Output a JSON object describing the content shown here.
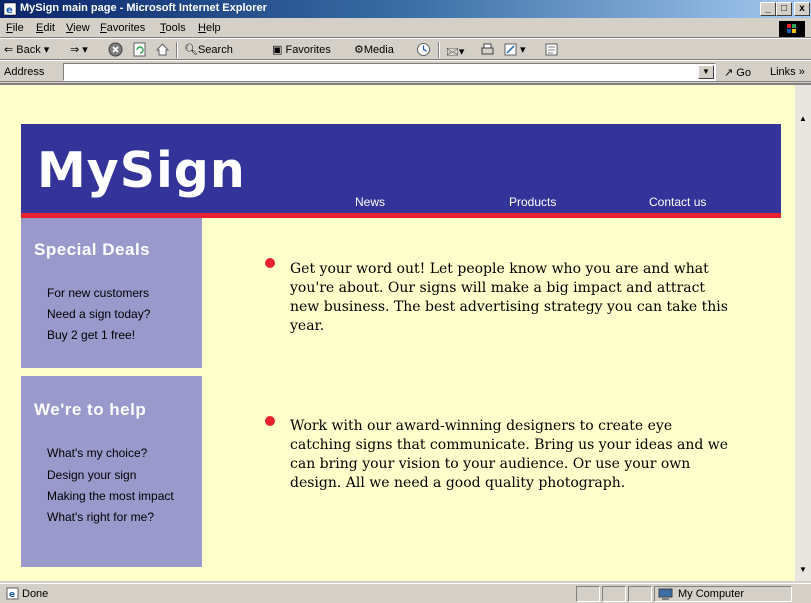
{
  "window": {
    "title": "MySign main page - Microsoft Internet Explorer",
    "controls": {
      "minimize": "_",
      "maximize": "□",
      "close": "x"
    }
  },
  "menubar": {
    "items": [
      {
        "label": "File"
      },
      {
        "label": "Edit"
      },
      {
        "label": "View"
      },
      {
        "label": "Favorites"
      },
      {
        "label": "Tools"
      },
      {
        "label": "Help"
      }
    ]
  },
  "toolbar": {
    "back_label": "Back",
    "search_label": "Search",
    "favorites_label": "Favorites",
    "media_label": "Media"
  },
  "addressbar": {
    "label": "Address",
    "value": "",
    "go_label": "Go",
    "links_label": "Links »"
  },
  "page": {
    "logo": "MySign",
    "nav": [
      {
        "label": "News"
      },
      {
        "label": "Products"
      },
      {
        "label": "Contact us"
      }
    ],
    "sidebar": [
      {
        "title": "Special Deals",
        "links": [
          "For new customers",
          "Need a sign today?",
          "Buy 2 get 1 free!"
        ]
      },
      {
        "title": "We're to help",
        "links": [
          "What's my choice?",
          "Design your sign",
          "Making the most impact",
          "What's right for me?"
        ]
      }
    ],
    "paragraphs": [
      "Get your word out! Let people know who you are and what you're about. Our signs will make a big impact and attract new business. The best advertising strategy you can take this year.",
      "Work with our award-winning designers to create eye catching signs that communicate. Bring us your ideas and we can bring your vision to your audience. Or use your own design. All we need a good quality photograph."
    ],
    "colors": {
      "background": "#ffffcc",
      "header": "#333399",
      "accent_red": "#e8232f",
      "sidebar": "#9999cc"
    }
  },
  "statusbar": {
    "status": "Done",
    "zone": "My Computer"
  }
}
